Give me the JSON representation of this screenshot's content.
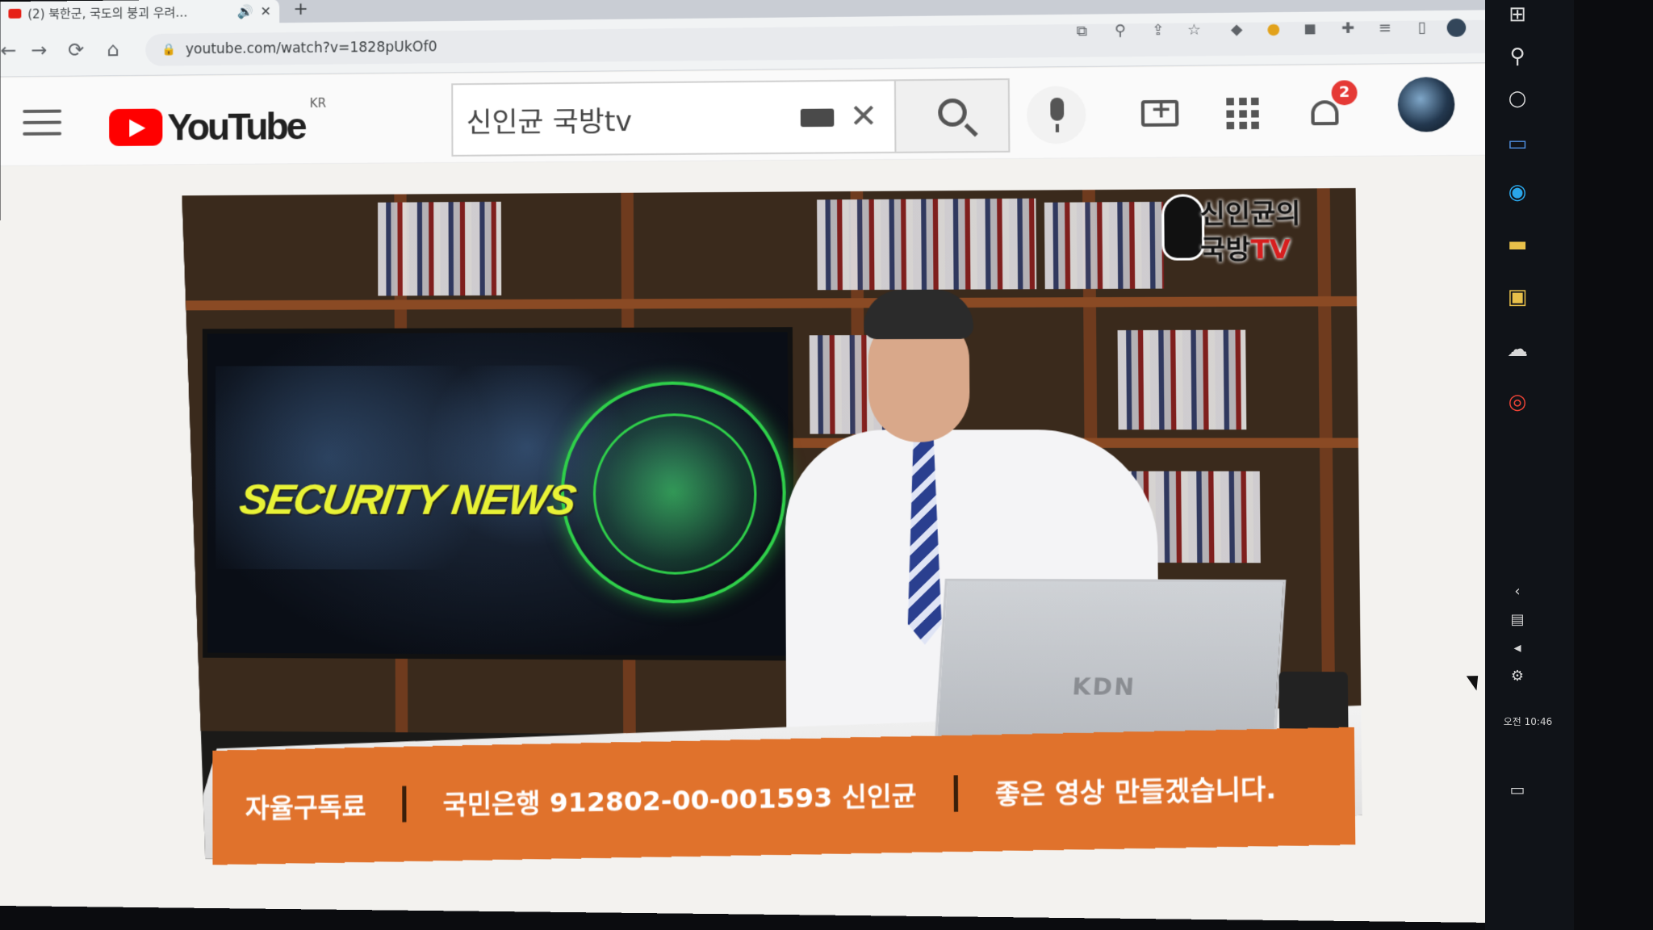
{
  "browser": {
    "tab_title": "(2) 북한군, 국도의 붕괴 우려…",
    "tab_mute_icon": "speaker-icon",
    "tab_close_icon": "close-icon",
    "new_tab_label": "+",
    "url": "youtube.com/watch?v=1828pUkOf0"
  },
  "youtube": {
    "logo_text": "YouTube",
    "region_code": "KR",
    "search_value": "신인균 국방tv",
    "notification_count": "2"
  },
  "video": {
    "overlay_title": "SECURITY NEWS",
    "channel_badge_line1": "신인균의",
    "channel_badge_line2": "국방",
    "channel_badge_tv": "TV",
    "laptop_brand": "KDN",
    "ticker": {
      "item1": "자율구독료",
      "item2": "국민은행 912802-00-001593 신인균",
      "item3": "좋은 영상 만들겠습니다."
    }
  },
  "taskbar": {
    "clock": "오전 10:46"
  },
  "colors": {
    "yt_red": "#ff0000",
    "ticker_orange": "#e0722c",
    "radar_green": "#2fcf4a",
    "badge_red": "#e53935"
  }
}
